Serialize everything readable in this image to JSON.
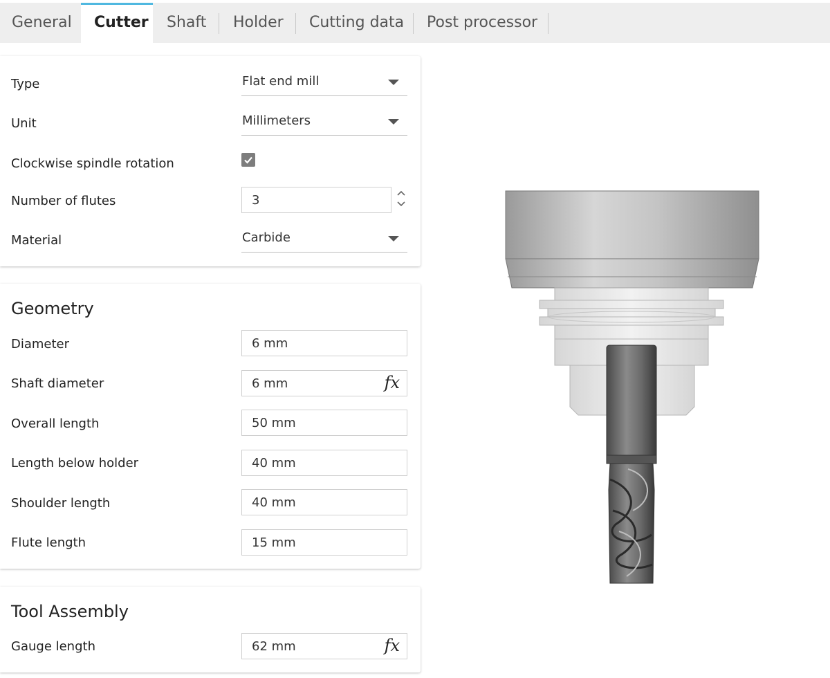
{
  "tabs": [
    {
      "label": "General"
    },
    {
      "label": "Cutter"
    },
    {
      "label": "Shaft"
    },
    {
      "label": "Holder"
    },
    {
      "label": "Cutting data"
    },
    {
      "label": "Post processor"
    }
  ],
  "active_tab": "Cutter",
  "accent_color": "#4fb8e0",
  "cutter": {
    "type_label": "Type",
    "type_value": "Flat end mill",
    "unit_label": "Unit",
    "unit_value": "Millimeters",
    "clockwise_label": "Clockwise spindle rotation",
    "clockwise_checked": true,
    "flutes_label": "Number of flutes",
    "flutes_value": "3",
    "material_label": "Material",
    "material_value": "Carbide"
  },
  "geometry": {
    "title": "Geometry",
    "diameter_label": "Diameter",
    "diameter_value": "6 mm",
    "shaft_diameter_label": "Shaft diameter",
    "shaft_diameter_value": "6 mm",
    "overall_length_label": "Overall length",
    "overall_length_value": "50 mm",
    "length_below_holder_label": "Length below holder",
    "length_below_holder_value": "40 mm",
    "shoulder_length_label": "Shoulder length",
    "shoulder_length_value": "40 mm",
    "flute_length_label": "Flute length",
    "flute_length_value": "15 mm"
  },
  "tool_assembly": {
    "title": "Tool Assembly",
    "gauge_length_label": "Gauge length",
    "gauge_length_value": "62 mm"
  },
  "icons": {
    "formula": "fx",
    "dropdown": "caret-down-icon",
    "checkbox": "checkmark-icon",
    "spinner": "up-down-stepper-icon"
  }
}
